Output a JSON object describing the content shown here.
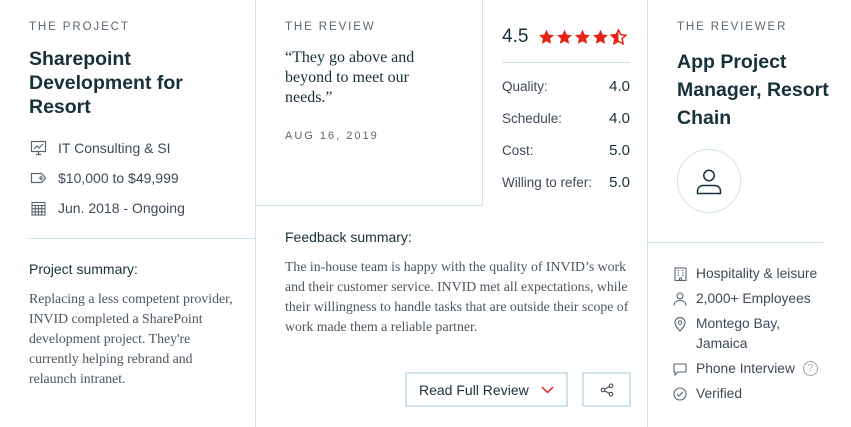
{
  "project": {
    "eyebrow": "THE PROJECT",
    "title": "Sharepoint Development for Resort",
    "meta": [
      {
        "icon": "presentation-icon",
        "text": "IT Consulting & SI"
      },
      {
        "icon": "price-tag-icon",
        "text": "$10,000 to $49,999"
      },
      {
        "icon": "calendar-icon",
        "text": "Jun. 2018 - Ongoing"
      }
    ],
    "summary_label": "Project summary:",
    "summary_text": "Replacing a less competent provider, INVID completed a SharePoint development project. They're currently helping rebrand and relaunch intranet."
  },
  "review": {
    "eyebrow": "THE REVIEW",
    "quote": "“They go above and beyond to meet our needs.”",
    "date": "AUG 16, 2019",
    "overall": "4.5",
    "stars": 4.5,
    "ratings": [
      {
        "label": "Quality:",
        "value": "4.0"
      },
      {
        "label": "Schedule:",
        "value": "4.0"
      },
      {
        "label": "Cost:",
        "value": "5.0"
      },
      {
        "label": "Willing to refer:",
        "value": "5.0"
      }
    ],
    "feedback_label": "Feedback summary:",
    "feedback_text": "The in-house team is happy with the quality of INVID’s work and their customer service. INVID met all expectations, while their willingness to handle tasks that are outside their scope of work made them a reliable partner.",
    "read_button": "Read Full Review"
  },
  "reviewer": {
    "eyebrow": "THE REVIEWER",
    "title": "App Project Manager, Resort Chain",
    "meta": [
      {
        "icon": "building-icon",
        "text": "Hospitality & leisure"
      },
      {
        "icon": "person-icon",
        "text": "2,000+ Employees"
      },
      {
        "icon": "location-pin-icon",
        "text": "Montego Bay, Jamaica"
      },
      {
        "icon": "chat-bubble-icon",
        "text": "Phone Interview"
      },
      {
        "icon": "check-circle-icon",
        "text": "Verified"
      }
    ]
  },
  "colors": {
    "star": "#e62415",
    "divider": "#cfe3ea",
    "heading": "#17313b"
  }
}
